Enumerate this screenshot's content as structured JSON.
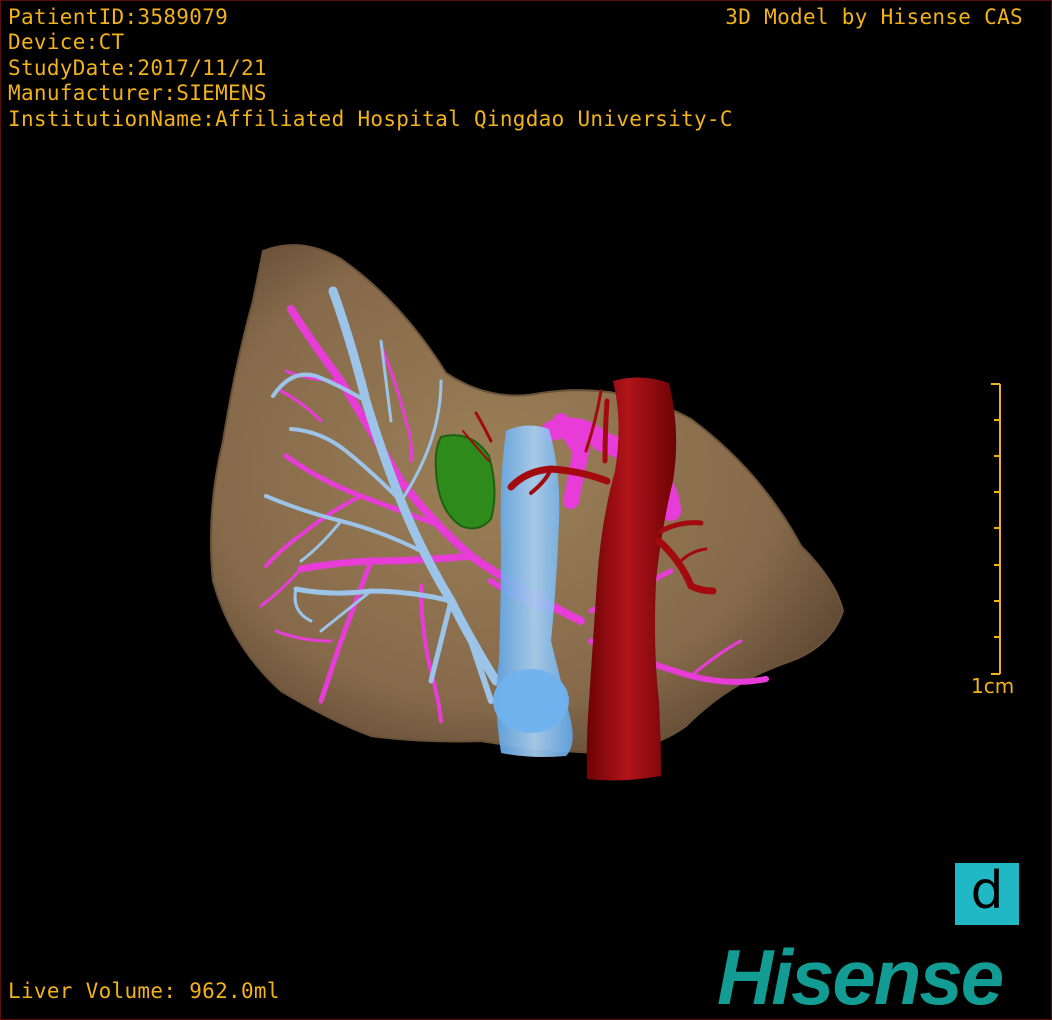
{
  "header_info": {
    "patient_id": "PatientID:3589079",
    "device": "Device:CT",
    "study_date": "StudyDate:2017/11/21",
    "manufacturer": "Manufacturer:SIEMENS",
    "institution": "InstitutionName:Affiliated Hospital Qingdao University-C"
  },
  "model_credit": "3D Model by Hisense CAS",
  "scale": {
    "label": "1cm"
  },
  "volume": {
    "text": "Liver Volume:  962.0ml"
  },
  "badge": {
    "letter": "d"
  },
  "brand": {
    "name": "Hisense"
  },
  "colors": {
    "overlay_text": "#f1b21a",
    "liver": "#8c7250",
    "portal_vein": "#e83cd9",
    "hepatic_vein": "#9cc4e8",
    "ivc": "#6fb2ee",
    "aorta": "#a20a0e",
    "gallbladder": "#2e8a1a",
    "badge": "#1fb8c4",
    "brand": "#129c93"
  }
}
